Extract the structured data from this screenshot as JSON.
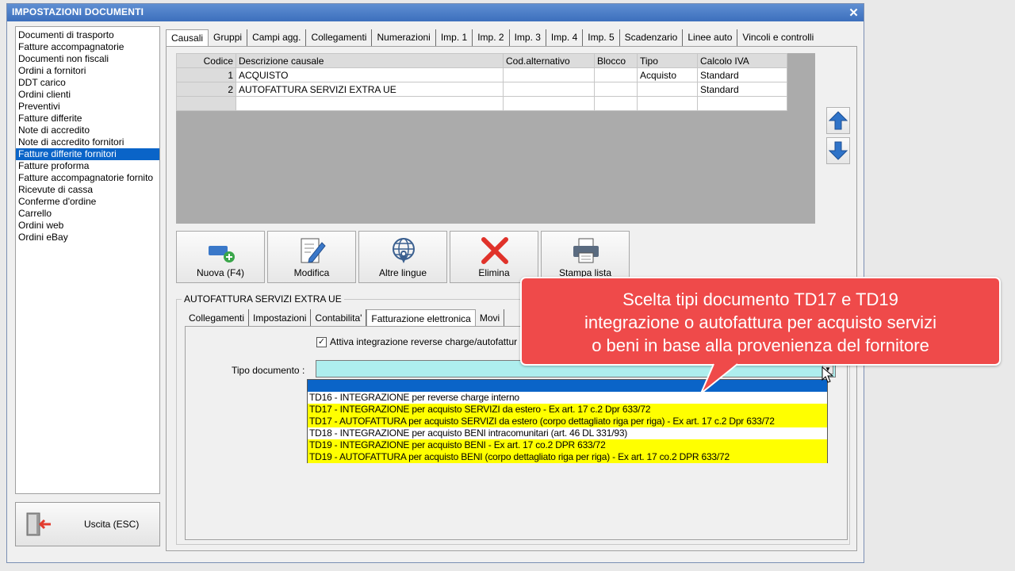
{
  "window": {
    "title": "IMPOSTAZIONI DOCUMENTI"
  },
  "sidebar": {
    "items": [
      "Documenti di trasporto",
      "Fatture accompagnatorie",
      "Documenti non fiscali",
      "Ordini a fornitori",
      "DDT carico",
      "Ordini clienti",
      "Preventivi",
      "Fatture differite",
      "Note di accredito",
      "Note di accredito fornitori",
      "Fatture differite fornitori",
      "Fatture proforma",
      "Fatture accompagnatorie fornito",
      "Ricevute di cassa",
      "Conferme d'ordine",
      "Carrello",
      "Ordini web",
      "Ordini eBay"
    ],
    "selected": "Fatture differite fornitori",
    "exit_label": "Uscita (ESC)"
  },
  "tabs": [
    "Causali",
    "Gruppi",
    "Campi agg.",
    "Collegamenti",
    "Numerazioni",
    "Imp. 1",
    "Imp. 2",
    "Imp. 3",
    "Imp. 4",
    "Imp. 5",
    "Scadenzario",
    "Linee auto",
    "Vincoli e controlli"
  ],
  "active_tab": "Causali",
  "grid": {
    "headers": [
      "Codice",
      "Descrizione causale",
      "Cod.alternativo",
      "Blocco",
      "Tipo",
      "Calcolo IVA"
    ],
    "rows": [
      [
        "1",
        "ACQUISTO",
        "",
        "",
        "Acquisto",
        "Standard"
      ],
      [
        "2",
        "AUTOFATTURA SERVIZI EXTRA UE",
        "",
        "",
        "",
        "Standard"
      ],
      [
        "",
        "",
        "",
        "",
        "",
        ""
      ]
    ]
  },
  "toolbar": {
    "buttons": [
      {
        "label": "Nuova (F4)",
        "icon": "new-plus-icon"
      },
      {
        "label": "Modifica",
        "icon": "edit-pencil-icon"
      },
      {
        "label": "Altre lingue",
        "icon": "globe-icon"
      },
      {
        "label": "Elimina",
        "icon": "delete-x-icon"
      },
      {
        "label": "Stampa lista",
        "icon": "printer-icon"
      }
    ]
  },
  "detail": {
    "group_title": "AUTOFATTURA SERVIZI EXTRA UE",
    "subtabs": [
      "Collegamenti",
      "Impostazioni",
      "Contabilita'",
      "Fatturazione elettronica",
      "Movi"
    ],
    "active_subtab": "Fatturazione elettronica",
    "checkbox_label": "Attiva integrazione reverse charge/autofattur",
    "checkbox_checked": true,
    "tipo_documento_label": "Tipo documento :",
    "tipo_documento_value": ""
  },
  "dropdown": {
    "options": [
      {
        "text": "",
        "style": "selected"
      },
      {
        "text": "TD16 - INTEGRAZIONE per reverse charge interno",
        "style": "normal"
      },
      {
        "text": "TD17 - INTEGRAZIONE per acquisto SERVIZI da estero - Ex art. 17 c.2 Dpr 633/72",
        "style": "highlight"
      },
      {
        "text": "TD17 - AUTOFATTURA per acquisto SERVIZI da estero (corpo dettagliato riga per riga) - Ex art. 17 c.2 Dpr 633/72",
        "style": "highlight"
      },
      {
        "text": "TD18 - INTEGRAZIONE per acquisto BENI intracomunitari (art. 46 DL 331/93)",
        "style": "normal"
      },
      {
        "text": "TD19 - INTEGRAZIONE per acquisto BENI - Ex art. 17 co.2 DPR 633/72",
        "style": "highlight"
      },
      {
        "text": "TD19 - AUTOFATTURA per acquisto BENI (corpo dettagliato riga per riga) - Ex art. 17 co.2 DPR 633/72",
        "style": "highlight"
      }
    ]
  },
  "callout": {
    "lines": [
      "Scelta tipi documento TD17 e TD19",
      "integrazione o autofattura per acquisto servizi",
      "o beni in base alla provenienza del fornitore"
    ]
  },
  "colors": {
    "title_bar": "#3c6fbd",
    "selection": "#0a64c8",
    "highlight": "#ffff00",
    "combo_bg": "#aeeeee",
    "callout_bg": "#ef4a4a"
  }
}
